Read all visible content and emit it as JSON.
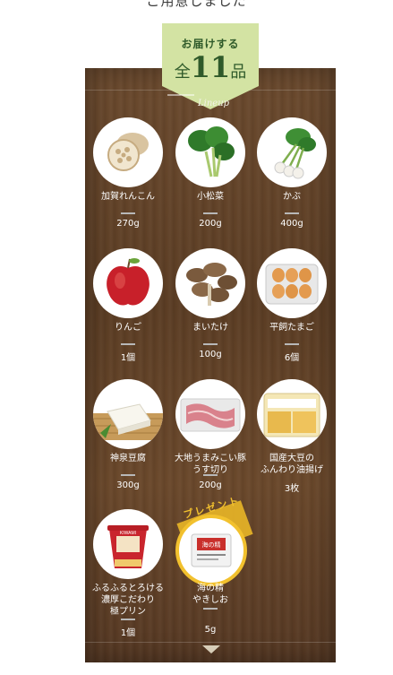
{
  "header": {
    "top_text": "ご用意しました",
    "ribbon_small": "お届けする",
    "ribbon_pre": "全",
    "ribbon_num": "11",
    "ribbon_post": "品",
    "ribbon_script": "Lineup"
  },
  "items": [
    {
      "name": "加賀れんこん",
      "qty": "270g",
      "icon": "lotus-root-icon"
    },
    {
      "name": "小松菜",
      "qty": "200g",
      "icon": "komatsuna-icon"
    },
    {
      "name": "かぶ",
      "qty": "400g",
      "icon": "turnip-icon"
    },
    {
      "name": "りんご",
      "qty": "1個",
      "icon": "apple-icon"
    },
    {
      "name": "まいたけ",
      "qty": "100g",
      "icon": "maitake-icon"
    },
    {
      "name": "平飼たまご",
      "qty": "6個",
      "icon": "eggs-icon"
    },
    {
      "name": "神泉豆腐",
      "qty": "300g",
      "icon": "tofu-icon"
    },
    {
      "name": "大地うまみこい豚\nうす切り",
      "qty": "200g",
      "icon": "pork-icon"
    },
    {
      "name": "国産大豆の\nふんわり油揚げ",
      "qty": "3枚",
      "icon": "abura-age-icon"
    },
    {
      "name": "ふるふるとろける\n濃厚こだわり\n極プリン",
      "qty": "1個",
      "icon": "pudding-icon"
    },
    {
      "name": "海の精\nやきしお",
      "qty": "5g",
      "icon": "salt-icon"
    }
  ],
  "present_label": "プレゼント",
  "pudding_label": "KIWAMI",
  "salt_label": "海の精"
}
